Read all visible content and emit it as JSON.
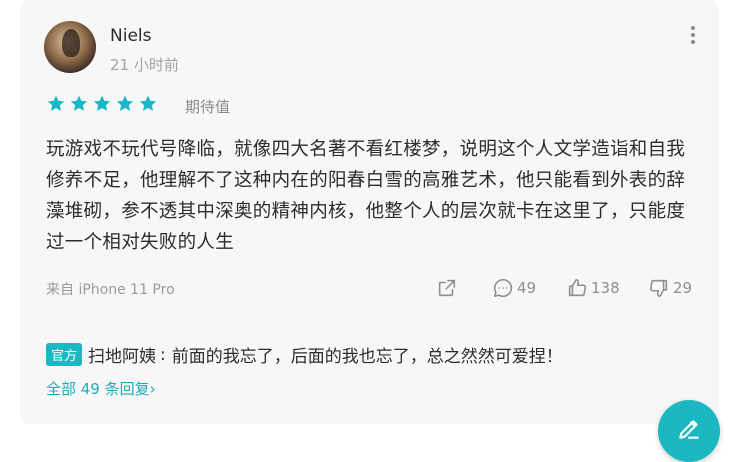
{
  "comment": {
    "author": "Niels",
    "time": "21 小时前",
    "rating_label": "期待值",
    "rating_stars": 5,
    "text": "玩游戏不玩代号降临，就像四大名著不看红楼梦，说明这个人文学造诣和自我修养不足，他理解不了这种内在的阳春白雪的高雅艺术，他只能看到外表的辞藻堆砌，参不透其中深奥的精神内核，他整个人的层次就卡在这里了，只能度过一个相对失败的人生",
    "device": "来自 iPhone 11 Pro",
    "reply_count": "49",
    "like_count": "138",
    "dislike_count": "29"
  },
  "reply": {
    "badge": "官方",
    "user": "扫地阿姨",
    "separator": ":",
    "text": "前面的我忘了，后面的我也忘了，总之然然可爱捏！"
  },
  "all_replies_label": "全部 49 条回复",
  "colors": {
    "accent": "#19b8c4",
    "star": "#17b9c9"
  }
}
